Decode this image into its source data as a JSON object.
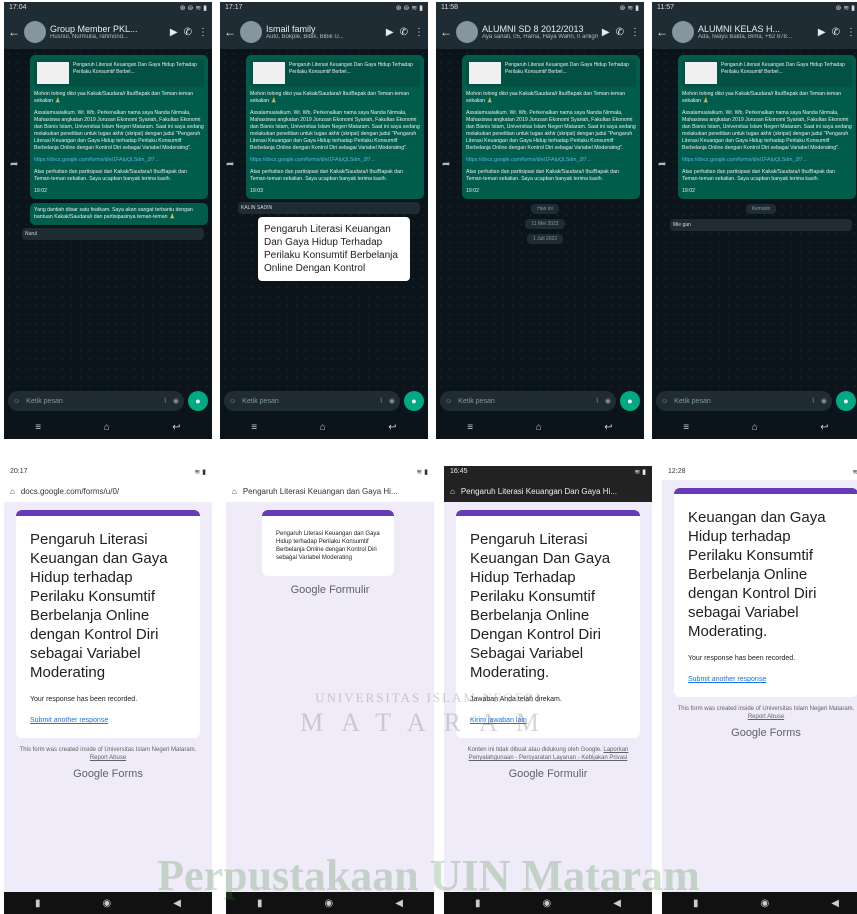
{
  "whatsapp_panels": [
    {
      "status_time": "17:04",
      "status_icons": "⊛ ⊜ ≋ ▮",
      "group_name": "Group Member PKL...",
      "members": "Husnul, Nurmulia, rahmond...",
      "top_caption": "",
      "preview_title": "Pengaruh Literasi Keuangan Dan Gaya Hidup Terhadap Perilaku Konsumtif Berbel...",
      "greeting": "Mohon tolong diisi yaa Kakak/Saudara/i Ibu/Bapak dan Teman-teman sekalian 🙏",
      "intro": "Assalamualaikum. Wr. Wb. Perkenalkan nama saya Nanda Nirmala, Mahasiswa angkatan 2019 Jurusan Ekonomi Syariah, Fakultas Ekonomi dan Bisnis Islam, Universitas Islam Negeri Mataram. Saat ini saya sedang melakukan penelitian untuk tugas akhir (skripsi) dengan judul \"Pengaruh Literasi Keuangan dan Gaya Hidup terhadap Perilaku Konsumtif Berbelanja Online dengan Kontrol Diri sebagai Variabel Moderating\".",
      "link": "https://docs.google.com/forms/d/e/1FAIpQLSdm_2f7...",
      "thanks": "Atas perhatian dan partisipasi dari Kakak/Saudara/i Ibu/Bapak dan Teman-teman sekalian. Saya ucapkan banyak terima kasih.",
      "time": "19:02",
      "extra": [
        "Yang dantiah diisar satu featkam. Saya akan sangat terbantu dengan bantuan Kakak/Saudara/i dan partisipasinya teman-teman 🙏"
      ],
      "incoming": "Nurul",
      "input_placeholder": "Ketik pesan"
    },
    {
      "status_time": "17:17",
      "status_icons": "⊛ ⊜ ≋ ▮",
      "group_name": "Ismail family",
      "members": "Auto, Bokple, Bibik, Bibik U...",
      "top_caption": "",
      "preview_title": "Pengaruh Literasi Keuangan Dan Gaya Hidup Terhadap Perilaku Konsumtif Berbel...",
      "greeting": "Mohon tolong diisi yaa Kakak/Saudara/i Ibu/Bapak dan Teman-teman sekalian 🙏",
      "intro": "Assalamualaikum. Wr. Wb. Perkenalkan nama saya Nanda Nirmala, Mahasiswa angkatan 2019 Jurusan Ekonomi Syariah, Fakultas Ekonomi dan Bisnis Islam, Universitas Islam Negeri Mataram. Saat ini saya sedang melakukan penelitian untuk tugas akhir (skripsi) dengan judul \"Pengaruh Literasi Keuangan dan Gaya Hidup terhadap Perilaku Konsumtif Berbelanja Online dengan Kontrol Diri sebagai Variabel Moderating\".",
      "link": "https://docs.google.com/forms/d/e/1FAIpQLSdm_2f7...",
      "thanks": "Atas perhatian dan partisipasi dari Kakak/Saudara/i Ibu/Bapak dan Teman-teman sekalian. Saya ucapkan banyak terima kasih.",
      "time": "19:03",
      "extra": [],
      "incoming": "KALIN SADIN",
      "form_card": "Pengaruh Literasi Keuangan Dan Gaya Hidup Terhadap Perilaku Konsumtif Berbelanja Online Dengan Kontrol",
      "input_placeholder": "Ketik pesan"
    },
    {
      "status_time": "11:58",
      "status_icons": "⊛ ≋ ▮",
      "group_name": "ALUMNI SD 8 2012/2013",
      "members": "Aya sanati, 05, Hama, Haya Wahri, 0 anligmar...",
      "top_caption": "",
      "preview_title": "Pengaruh Literasi Keuangan Dan Gaya Hidup Terhadap Perilaku Konsumtif Berbel...",
      "greeting": "Mohon tolong diisi yaa Kakak/Saudara/i Ibu/Bapak dan Teman-teman sekalian 🙏",
      "intro": "Assalamualaikum. Wr. Wb. Perkenalkan nama saya Nanda Nirmala, Mahasiswa angkatan 2019 Jurusan Ekonomi Syariah, Fakultas Ekonomi dan Bisnis Islam, Universitas Islam Negeri Mataram. Saat ini saya sedang melakukan penelitian untuk tugas akhir (skripsi) dengan judul \"Pengaruh Literasi Keuangan dan Gaya Hidup terhadap Perilaku Konsumtif Berbelanja Online dengan Kontrol Diri sebagai Variabel Moderating\".",
      "link": "https://docs.google.com/forms/d/e/1FAIpQLSdm_2f7...",
      "thanks": "Atas perhatian dan partisipasi dari Kakak/Saudara/i Ibu/Bapak dan Teman-teman sekalian. Saya ucapkan banyak terima kasih.",
      "time": "19:02",
      "extra": [],
      "dates": [
        "Hari ini",
        "11 Mei 2023",
        "1 Juli 2023"
      ],
      "input_placeholder": "Ketik pesan"
    },
    {
      "status_time": "11:57",
      "status_icons": "⊛ ≋ ▮",
      "group_name": "ALUMNI KELAS H...",
      "members": "Ada, Iwayu Balda, Bima, +62 878...",
      "top_caption": "",
      "preview_title": "Pengaruh Literasi Keuangan Dan Gaya Hidup Terhadap Perilaku Konsumtif Berbel...",
      "greeting": "Mohon tolong diisi yaa Kakak/Saudara/i Ibu/Bapak dan Teman-teman sekalian 🙏",
      "intro": "Assalamualaikum. Wr. Wb. Perkenalkan nama saya Nanda Nirmala, Mahasiswa angkatan 2019 Jurusan Ekonomi Syariah, Fakultas Ekonomi dan Bisnis Islam, Universitas Islam Negeri Mataram. Saat ini saya sedang melakukan penelitian untuk tugas akhir (skripsi) dengan judul \"Pengaruh Literasi Keuangan dan Gaya Hidup terhadap Perilaku Konsumtif Berbelanja Online dengan Kontrol Diri sebagai Variabel Moderating\".",
      "link": "https://docs.google.com/forms/d/e/1FAIpQLSdm_2f7...",
      "thanks": "Atas perhatian dan partisipasi dari Kakak/Saudara/i Ibu/Bapak dan Teman-teman sekalian. Saya ucapkan banyak terima kasih.",
      "time": "19:02",
      "extra": [],
      "dates": [
        "Kemarin"
      ],
      "incoming_msg": "Mie gan",
      "input_placeholder": "Ketik pesan"
    }
  ],
  "form_panels": [
    {
      "status_time": "20:17",
      "url": "docs.google.com/forms/u/0/",
      "title": "Pengaruh Literasi Keuangan dan Gaya Hidup terhadap Perilaku Konsumtif Berbelanja Online dengan Kontrol Diri sebagai Variabel Moderating",
      "recorded": "Your response has been recorded.",
      "submit": "Submit another response",
      "footer": "This form was created inside of Universitas Islam Negeri Mataram.",
      "report": "Report Abuse",
      "brand": "Google Forms"
    },
    {
      "status_time": "",
      "url": "Pengaruh Literasi Keuangan dan Gaya Hi...",
      "title": "Pengaruh Literasi Keuangan dan Gaya Hidup terhadap Perilaku Konsumtif Berbelanja Online dengan Kontrol Diri sebagai Variabel Moderating",
      "recorded": "",
      "submit": "",
      "footer": "",
      "report": "",
      "brand": "Google Formulir"
    },
    {
      "status_time": "16:45",
      "url": "Pengaruh Literasi Keuangan Dan Gaya Hi...",
      "title": "Pengaruh Literasi Keuangan Dan Gaya Hidup Terhadap Perilaku Konsumtif Berbelanja Online Dengan Kontrol Diri Sebagai Variabel Moderating.",
      "recorded": "Jawaban Anda telah direkam.",
      "submit": "Kirim jawaban lain",
      "footer": "Konten ini tidak dibuat atau didukung oleh Google.",
      "report": "Laporkan Penyalahgunaan - Persyaratan Layanan - Kebijakan Privasi",
      "brand": "Google Formulir"
    },
    {
      "status_time": "12:28",
      "url": "",
      "title": "Keuangan dan Gaya Hidup terhadap Perilaku Konsumtif Berbelanja Online dengan Kontrol Diri sebagai Variabel Moderating.",
      "recorded": "Your response has been recorded.",
      "submit": "Submit another response",
      "footer": "This form was created inside of Universitas Islam Negeri Mataram.",
      "report": "Report Abuse",
      "brand": "Google Forms"
    }
  ],
  "watermark": {
    "university": "UNIVERSITAS ISLAM NEGERI",
    "city": "MATARAM",
    "library": "Perpustakaan UIN Mataram"
  },
  "colors": {
    "wa_bg": "#0b141a",
    "wa_bubble": "#005c4b",
    "forms_accent": "#673ab7",
    "forms_bg": "#f0ebf8"
  }
}
